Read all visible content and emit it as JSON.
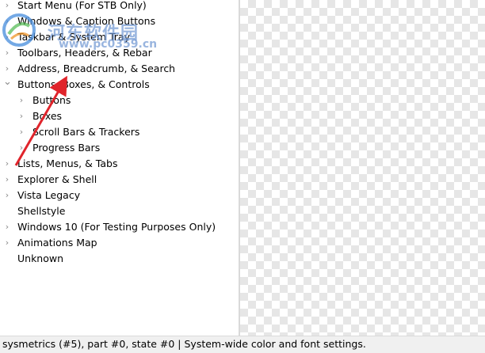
{
  "tree": {
    "items": [
      {
        "label": "Start Menu (For STB Only)",
        "level": 0,
        "expander": "collapsed"
      },
      {
        "label": "Windows & Caption Buttons",
        "level": 0,
        "expander": "collapsed"
      },
      {
        "label": "Taskbar & System Tray",
        "level": 0,
        "expander": "collapsed"
      },
      {
        "label": "Toolbars, Headers, & Rebar",
        "level": 0,
        "expander": "collapsed"
      },
      {
        "label": "Address, Breadcrumb, & Search",
        "level": 0,
        "expander": "collapsed"
      },
      {
        "label": "Buttons, Boxes, & Controls",
        "level": 0,
        "expander": "expanded"
      },
      {
        "label": "Buttons",
        "level": 1,
        "expander": "collapsed"
      },
      {
        "label": "Boxes",
        "level": 1,
        "expander": "collapsed"
      },
      {
        "label": "Scroll Bars & Trackers",
        "level": 1,
        "expander": "collapsed"
      },
      {
        "label": "Progress Bars",
        "level": 1,
        "expander": "collapsed"
      },
      {
        "label": "Lists, Menus, & Tabs",
        "level": 0,
        "expander": "collapsed"
      },
      {
        "label": "Explorer & Shell",
        "level": 0,
        "expander": "collapsed"
      },
      {
        "label": "Vista Legacy",
        "level": 0,
        "expander": "collapsed"
      },
      {
        "label": "Shellstyle",
        "level": 0,
        "expander": "none"
      },
      {
        "label": "Windows 10 (For Testing Purposes Only)",
        "level": 0,
        "expander": "collapsed"
      },
      {
        "label": "Animations Map",
        "level": 0,
        "expander": "collapsed"
      },
      {
        "label": "Unknown",
        "level": 0,
        "expander": "none"
      }
    ]
  },
  "status": {
    "text": "sysmetrics (#5),  part #0,  state #0  |  System-wide color and font settings."
  },
  "watermark": {
    "name": "河东软件园",
    "url": "www.pc0359.cn"
  },
  "icons": {
    "collapsed": "chevron-right-icon",
    "expanded": "chevron-down-icon"
  },
  "colors": {
    "checker": "#e6e6e6",
    "arrow": "#e0242b",
    "status_bg": "#f0f0f0"
  }
}
